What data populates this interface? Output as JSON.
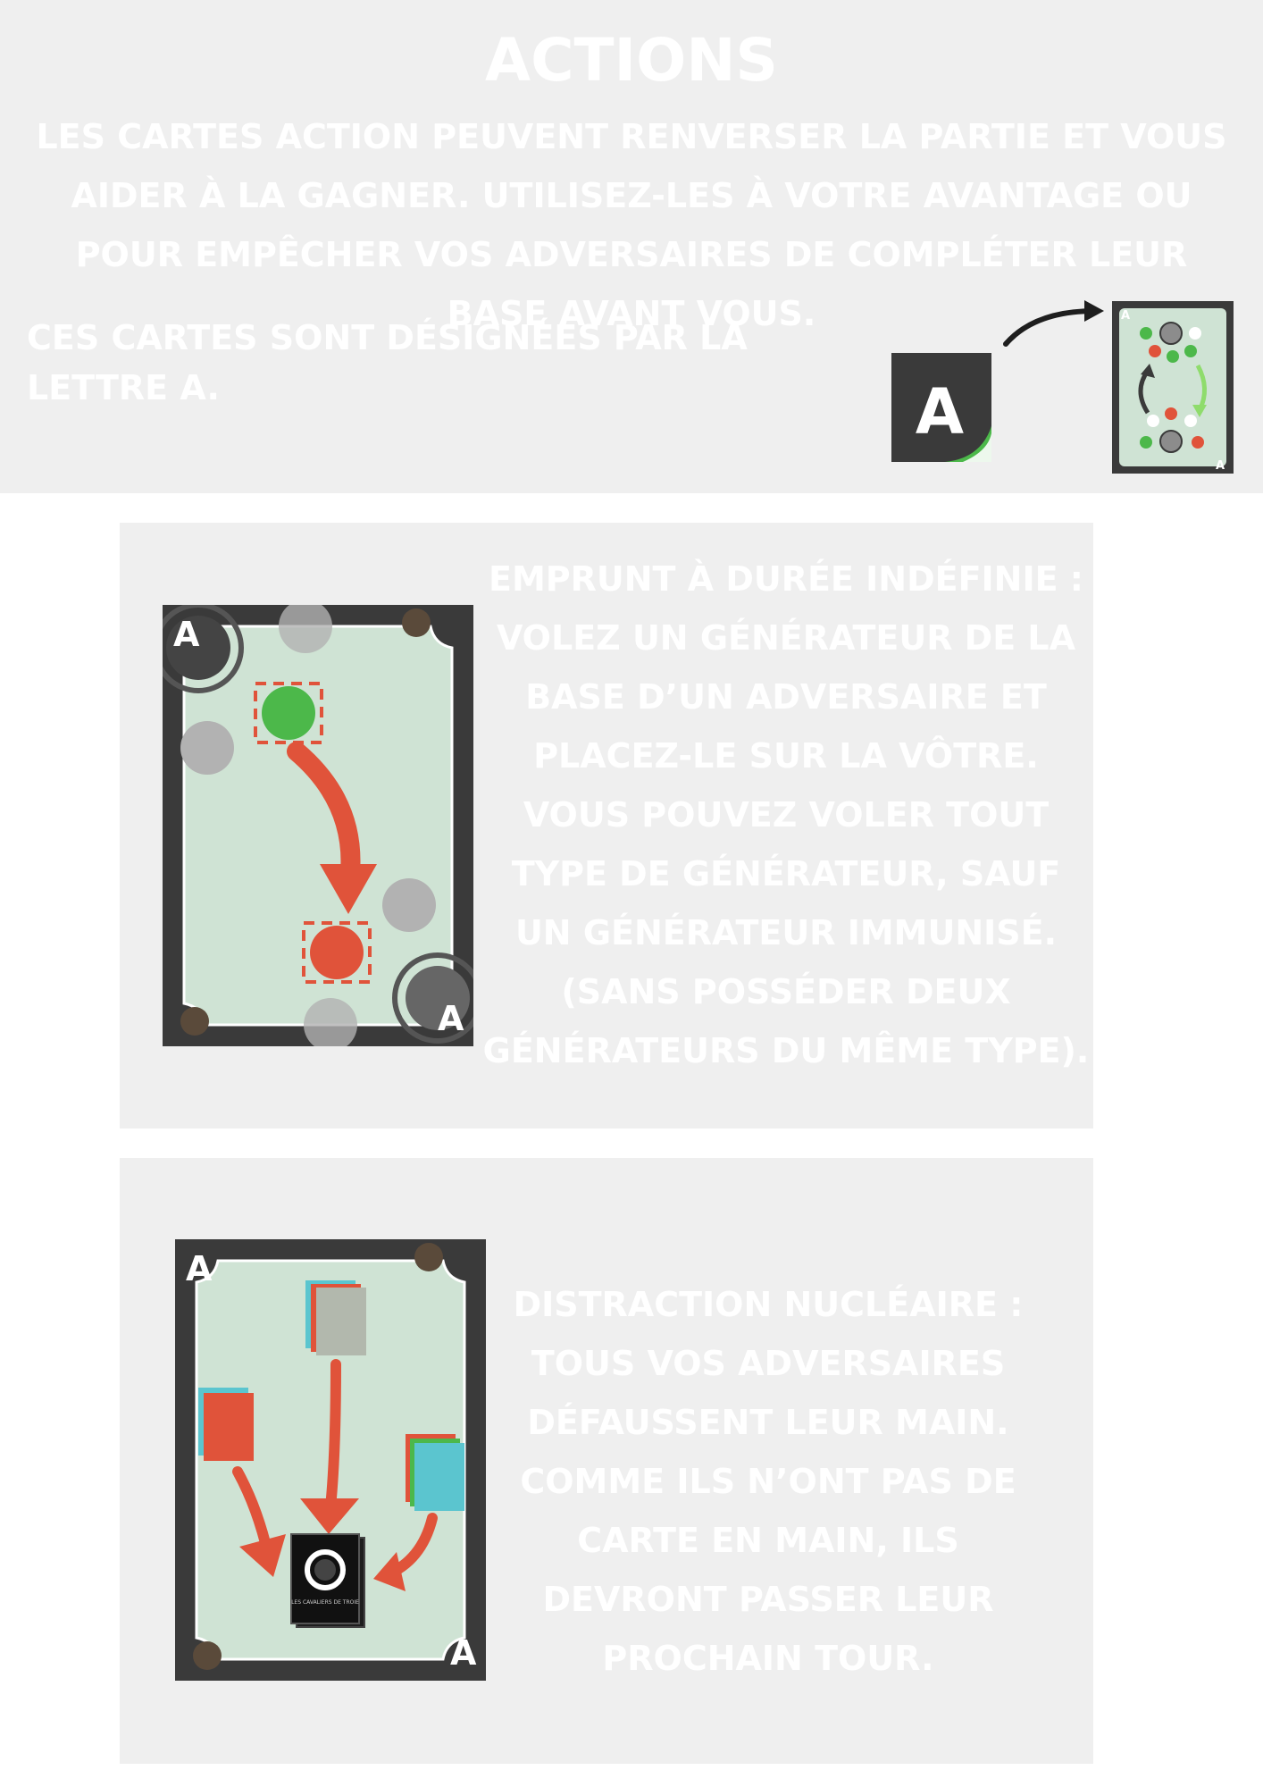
{
  "header": {
    "title": "ACTIONS",
    "intro": "LES CARTES ACTION PEUVENT RENVERSER LA PARTIE ET VOUS AIDER À LA GAGNER. UTILISEZ-LES À VOTRE AVANTAGE OU POUR EMPÊCHER VOS ADVERSAIRES DE COMPLÉTER LEUR BASE AVANT VOUS.",
    "designation": "CES CARTES SONT DÉSIGNÉES PAR LA LETTRE A.",
    "badge_letter": "A"
  },
  "cards": [
    {
      "letter": "A",
      "description": "EMPRUNT À DURÉE INDÉFINIE : VOLEZ UN GÉNÉRATEUR DE LA BASE D’UN ADVERSAIRE ET PLACEZ-LE SUR LA VÔTRE. VOUS POUVEZ VOLER TOUT TYPE DE GÉNÉRATEUR, SAUF UN GÉNÉRATEUR IMMUNISÉ. (SANS POSSÉDER DEUX GÉNÉRATEURS DU MÊME TYPE)."
    },
    {
      "letter": "A",
      "description": "DISTRACTION NUCLÉAIRE : TOUS VOS ADVERSAIRES DÉFAUSSENT LEUR MAIN. COMME ILS N’ONT PAS DE CARTE EN MAIN, ILS DEVRONT PASSER LEUR PROCHAIN TOUR.",
      "deck_label": "LES CAVALIERS DE TROIE"
    }
  ],
  "colors": {
    "card_frame": "#3a3a3a",
    "card_face": "#cfe3d4",
    "green": "#4cb84a",
    "red": "#e0533a",
    "grey_dot": "#b2b2b2",
    "teal": "#5bc5cf",
    "panel_bg": "#efefef"
  }
}
